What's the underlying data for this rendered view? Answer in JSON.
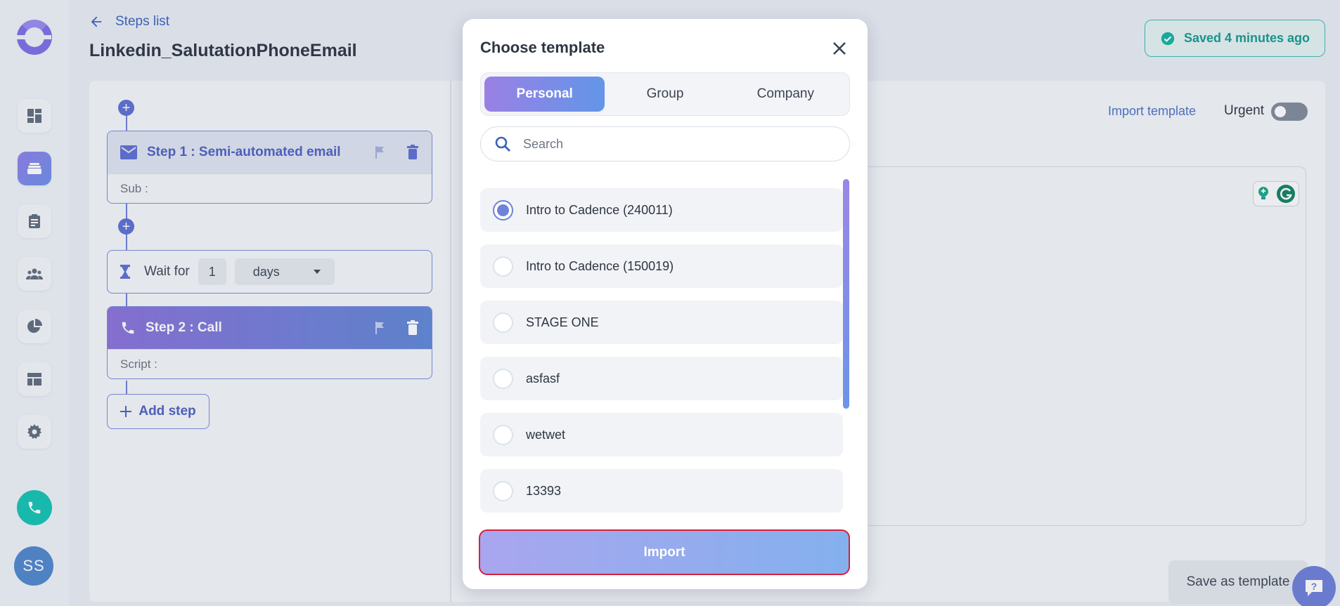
{
  "header": {
    "back_label": "Steps list",
    "title": "Linkedin_SalutationPhoneEmail",
    "saved_status": "Saved 4 minutes ago"
  },
  "sidebar": {
    "items": [
      {
        "name": "dashboard",
        "icon": "dashboard-icon"
      },
      {
        "name": "cadences",
        "icon": "stack-icon",
        "active": true
      },
      {
        "name": "tasks",
        "icon": "clipboard-icon"
      },
      {
        "name": "people",
        "icon": "people-icon"
      },
      {
        "name": "reports",
        "icon": "pie-chart-icon"
      },
      {
        "name": "templates",
        "icon": "layout-icon"
      },
      {
        "name": "settings",
        "icon": "gear-icon"
      }
    ],
    "avatar_initials": "SS"
  },
  "steps": {
    "step1": {
      "title": "Step 1 : Semi-automated email",
      "body_label": "Sub :"
    },
    "wait": {
      "label": "Wait for",
      "value": "1",
      "unit": "days"
    },
    "step2": {
      "title": "Step 2 : Call",
      "body_label": "Script :"
    },
    "add_step_label": "Add step"
  },
  "editor": {
    "import_template_label": "Import template",
    "urgent_label": "Urgent",
    "urgent_on": false,
    "save_as_template_label": "Save as template"
  },
  "modal": {
    "title": "Choose template",
    "tabs": [
      {
        "label": "Personal",
        "active": true
      },
      {
        "label": "Group",
        "active": false
      },
      {
        "label": "Company",
        "active": false
      }
    ],
    "search_placeholder": "Search",
    "templates": [
      {
        "label": "Intro to Cadence (240011)",
        "selected": true
      },
      {
        "label": "Intro to Cadence (150019)",
        "selected": false
      },
      {
        "label": "STAGE ONE",
        "selected": false
      },
      {
        "label": "asfasf",
        "selected": false
      },
      {
        "label": "wetwet",
        "selected": false
      },
      {
        "label": "13393",
        "selected": false
      }
    ],
    "import_label": "Import"
  },
  "colors": {
    "accent": "#6c7ed8",
    "saved_green": "#14998d",
    "import_border": "#d8203a"
  }
}
